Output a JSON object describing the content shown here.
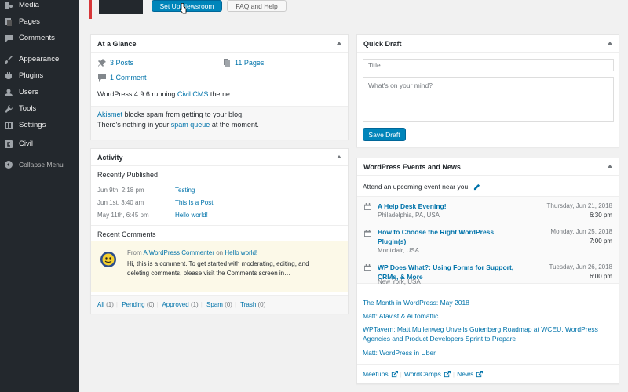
{
  "sidebar": {
    "items": [
      {
        "label": "Media",
        "icon": "media-icon"
      },
      {
        "label": "Pages",
        "icon": "pages-icon"
      },
      {
        "label": "Comments",
        "icon": "comments-icon"
      },
      {
        "label": "Appearance",
        "icon": "appearance-icon"
      },
      {
        "label": "Plugins",
        "icon": "plugins-icon"
      },
      {
        "label": "Users",
        "icon": "users-icon"
      },
      {
        "label": "Tools",
        "icon": "tools-icon"
      },
      {
        "label": "Settings",
        "icon": "settings-icon"
      },
      {
        "label": "Civil",
        "icon": "civil-icon"
      }
    ],
    "collapse_label": "Collapse Menu"
  },
  "top": {
    "setup_button": "Set Up Newsroom",
    "faq_button": "FAQ and Help"
  },
  "glance": {
    "title": "At a Glance",
    "posts": "3 Posts",
    "pages": "11 Pages",
    "comments": "1 Comment",
    "version_prefix": "WordPress 4.9.6 running ",
    "theme": "Civil CMS",
    "version_suffix": " theme.",
    "akismet_link": "Akismet",
    "akismet_text": " blocks spam from getting to your blog.",
    "spam_prefix": "There's nothing in your ",
    "spam_link": "spam queue",
    "spam_suffix": " at the moment."
  },
  "activity": {
    "title": "Activity",
    "recent_heading": "Recently Published",
    "posts": [
      {
        "date": "Jun 9th, 2:18 pm",
        "title": "Testing"
      },
      {
        "date": "Jun 1st, 3:40 am",
        "title": "This Is a Post"
      },
      {
        "date": "May 11th, 6:45 pm",
        "title": "Hello world!"
      }
    ],
    "comments_heading": "Recent Comments",
    "comment_from": "From ",
    "comment_author": "A WordPress Commenter",
    "comment_on": " on ",
    "comment_post": "Hello world!",
    "comment_line1": "Hi, this is a comment. To get started with moderating, editing, and",
    "comment_line2": "deleting comments, please visit the Comments screen in…",
    "filters": [
      {
        "label": "All",
        "count": "(1)"
      },
      {
        "label": "Pending",
        "count": "(0)"
      },
      {
        "label": "Approved",
        "count": "(1)"
      },
      {
        "label": "Spam",
        "count": "(0)"
      },
      {
        "label": "Trash",
        "count": "(0)"
      }
    ]
  },
  "quick_draft": {
    "title": "Quick Draft",
    "title_placeholder": "Title",
    "content_placeholder": "What's on your mind?",
    "save_button": "Save Draft"
  },
  "events": {
    "title": "WordPress Events and News",
    "attend_text": "Attend an upcoming event near you.",
    "items": [
      {
        "name": "A Help Desk Evening!",
        "name2": "",
        "location": "Philadelphia, PA, USA",
        "date": "Thursday, Jun 21, 2018",
        "time": "6:30 pm"
      },
      {
        "name": "How to Choose the Right WordPress",
        "name2": "Plugin(s)",
        "location": "Montclair, USA",
        "date": "Monday, Jun 25, 2018",
        "time": "7:00 pm"
      },
      {
        "name": "WP Does What?: Using Forms for Support,",
        "name2": "CRMs, & More",
        "location": "New York, USA",
        "date": "Tuesday, Jun 26, 2018",
        "time": "6:00 pm"
      }
    ],
    "news": [
      "The Month in WordPress: May 2018",
      "Matt: Atavist & Automattic",
      "WPTavern: Matt Mullenweg Unveils Gutenberg Roadmap at WCEU, WordPress",
      "Agencies and Product Developers Sprint to Prepare",
      "Matt: WordPress in Uber"
    ],
    "footer_links": [
      "Meetups",
      "WordCamps",
      "News"
    ]
  },
  "colors": {
    "sidebar_bg": "#23282d",
    "accent": "#0073aa",
    "button_primary": "#0085ba"
  }
}
